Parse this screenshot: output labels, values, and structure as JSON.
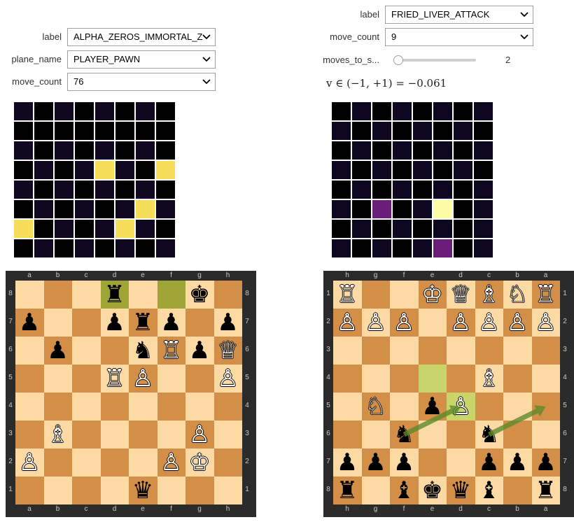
{
  "left_panel": {
    "controls": [
      {
        "label": "label",
        "value": "ALPHA_ZEROS_IMMORTAL_Z"
      },
      {
        "label": "plane_name",
        "value": "PLAYER_PAWN"
      },
      {
        "label": "move_count",
        "value": "76"
      }
    ],
    "plane": [
      [
        0,
        1,
        0,
        1,
        0,
        1,
        0,
        1
      ],
      [
        1,
        1,
        1,
        1,
        1,
        1,
        1,
        1
      ],
      [
        0,
        1,
        0,
        1,
        0,
        1,
        0,
        1
      ],
      [
        1,
        0,
        1,
        0,
        3,
        0,
        1,
        3
      ],
      [
        0,
        1,
        0,
        1,
        0,
        1,
        0,
        1
      ],
      [
        1,
        0,
        1,
        0,
        1,
        0,
        3,
        0
      ],
      [
        3,
        1,
        0,
        1,
        0,
        3,
        0,
        1
      ],
      [
        1,
        0,
        1,
        0,
        1,
        0,
        1,
        0
      ]
    ],
    "board": {
      "files": [
        "a",
        "b",
        "c",
        "d",
        "e",
        "f",
        "g",
        "h"
      ],
      "ranks": [
        "8",
        "7",
        "6",
        "5",
        "4",
        "3",
        "2",
        "1"
      ],
      "highlights": [
        {
          "r": 0,
          "c": 3
        },
        {
          "r": 0,
          "c": 5
        }
      ],
      "pieces": [
        {
          "r": 0,
          "c": 3,
          "p": "♜",
          "w": false
        },
        {
          "r": 0,
          "c": 6,
          "p": "♚",
          "w": false
        },
        {
          "r": 1,
          "c": 0,
          "p": "♟",
          "w": false
        },
        {
          "r": 1,
          "c": 3,
          "p": "♟",
          "w": false
        },
        {
          "r": 1,
          "c": 4,
          "p": "♜",
          "w": false
        },
        {
          "r": 1,
          "c": 5,
          "p": "♟",
          "w": false
        },
        {
          "r": 1,
          "c": 7,
          "p": "♟",
          "w": false
        },
        {
          "r": 2,
          "c": 1,
          "p": "♟",
          "w": false
        },
        {
          "r": 2,
          "c": 4,
          "p": "♞",
          "w": false
        },
        {
          "r": 2,
          "c": 5,
          "p": "♖",
          "w": true
        },
        {
          "r": 2,
          "c": 6,
          "p": "♟",
          "w": false
        },
        {
          "r": 2,
          "c": 7,
          "p": "♕",
          "w": true
        },
        {
          "r": 3,
          "c": 3,
          "p": "♖",
          "w": true
        },
        {
          "r": 3,
          "c": 4,
          "p": "♙",
          "w": true
        },
        {
          "r": 3,
          "c": 7,
          "p": "♙",
          "w": true
        },
        {
          "r": 5,
          "c": 1,
          "p": "♗",
          "w": true
        },
        {
          "r": 5,
          "c": 6,
          "p": "♙",
          "w": true
        },
        {
          "r": 6,
          "c": 0,
          "p": "♙",
          "w": true
        },
        {
          "r": 6,
          "c": 5,
          "p": "♙",
          "w": true
        },
        {
          "r": 6,
          "c": 6,
          "p": "♔",
          "w": true
        },
        {
          "r": 7,
          "c": 4,
          "p": "♛",
          "w": false
        }
      ]
    }
  },
  "right_panel": {
    "controls": [
      {
        "label": "label",
        "value": "FRIED_LIVER_ATTACK"
      },
      {
        "label": "move_count",
        "value": "9"
      }
    ],
    "slider": {
      "label": "moves_to_s...",
      "value": "2",
      "fraction": 0.0
    },
    "value_text": "v ∈ (−1, +1) = −0.061",
    "plane": [
      [
        0,
        1,
        0,
        1,
        0,
        1,
        0,
        1
      ],
      [
        1,
        0,
        1,
        0,
        1,
        0,
        1,
        0
      ],
      [
        0,
        1,
        0,
        1,
        0,
        1,
        0,
        1
      ],
      [
        1,
        0,
        1,
        0,
        1,
        0,
        1,
        0
      ],
      [
        0,
        1,
        0,
        1,
        0,
        1,
        0,
        1
      ],
      [
        1,
        0,
        2,
        0,
        1,
        3,
        0,
        1
      ],
      [
        0,
        1,
        0,
        1,
        0,
        1,
        0,
        1
      ],
      [
        1,
        0,
        1,
        0,
        1,
        2,
        0,
        1
      ]
    ],
    "board": {
      "files": [
        "h",
        "g",
        "f",
        "e",
        "d",
        "c",
        "b",
        "a"
      ],
      "ranks": [
        "1",
        "2",
        "3",
        "4",
        "5",
        "6",
        "7",
        "8"
      ],
      "highlights": [
        {
          "r": 3,
          "c": 3
        },
        {
          "r": 4,
          "c": 4
        }
      ],
      "pieces": [
        {
          "r": 0,
          "c": 0,
          "p": "♖",
          "w": true
        },
        {
          "r": 0,
          "c": 3,
          "p": "♔",
          "w": true
        },
        {
          "r": 0,
          "c": 4,
          "p": "♕",
          "w": true
        },
        {
          "r": 0,
          "c": 5,
          "p": "♗",
          "w": true
        },
        {
          "r": 0,
          "c": 6,
          "p": "♘",
          "w": true
        },
        {
          "r": 0,
          "c": 7,
          "p": "♖",
          "w": true
        },
        {
          "r": 1,
          "c": 0,
          "p": "♙",
          "w": true
        },
        {
          "r": 1,
          "c": 1,
          "p": "♙",
          "w": true
        },
        {
          "r": 1,
          "c": 2,
          "p": "♙",
          "w": true
        },
        {
          "r": 1,
          "c": 4,
          "p": "♙",
          "w": true
        },
        {
          "r": 1,
          "c": 5,
          "p": "♙",
          "w": true
        },
        {
          "r": 1,
          "c": 6,
          "p": "♙",
          "w": true
        },
        {
          "r": 1,
          "c": 7,
          "p": "♙",
          "w": true
        },
        {
          "r": 3,
          "c": 5,
          "p": "♗",
          "w": true
        },
        {
          "r": 4,
          "c": 1,
          "p": "♘",
          "w": true
        },
        {
          "r": 4,
          "c": 3,
          "p": "♟",
          "w": false
        },
        {
          "r": 4,
          "c": 4,
          "p": "♙",
          "w": true
        },
        {
          "r": 5,
          "c": 2,
          "p": "♞",
          "w": false
        },
        {
          "r": 5,
          "c": 5,
          "p": "♞",
          "w": false
        },
        {
          "r": 6,
          "c": 0,
          "p": "♟",
          "w": false
        },
        {
          "r": 6,
          "c": 1,
          "p": "♟",
          "w": false
        },
        {
          "r": 6,
          "c": 2,
          "p": "♟",
          "w": false
        },
        {
          "r": 6,
          "c": 5,
          "p": "♟",
          "w": false
        },
        {
          "r": 6,
          "c": 6,
          "p": "♟",
          "w": false
        },
        {
          "r": 6,
          "c": 7,
          "p": "♟",
          "w": false
        },
        {
          "r": 7,
          "c": 0,
          "p": "♜",
          "w": false
        },
        {
          "r": 7,
          "c": 2,
          "p": "♝",
          "w": false
        },
        {
          "r": 7,
          "c": 3,
          "p": "♚",
          "w": false
        },
        {
          "r": 7,
          "c": 4,
          "p": "♛",
          "w": false
        },
        {
          "r": 7,
          "c": 5,
          "p": "♝",
          "w": false
        },
        {
          "r": 7,
          "c": 7,
          "p": "♜",
          "w": false
        }
      ],
      "arrows": [
        {
          "from": {
            "r": 5,
            "c": 2
          },
          "to": {
            "r": 4,
            "c": 4
          }
        },
        {
          "from": {
            "r": 5,
            "c": 5
          },
          "to": {
            "r": 4,
            "c": 7
          }
        }
      ]
    }
  },
  "colors": {
    "plane_levels": [
      "#0f0820",
      "#000000",
      "#2a0e45",
      "#f7de5a"
    ],
    "plane_levels_alt": [
      "#000000",
      "#0d0722",
      "#6b1d7a",
      "#fcfca4"
    ],
    "highlight": "#9fa437",
    "highlight_right": "#c9d46a",
    "arrow": "#5c8a2c"
  }
}
